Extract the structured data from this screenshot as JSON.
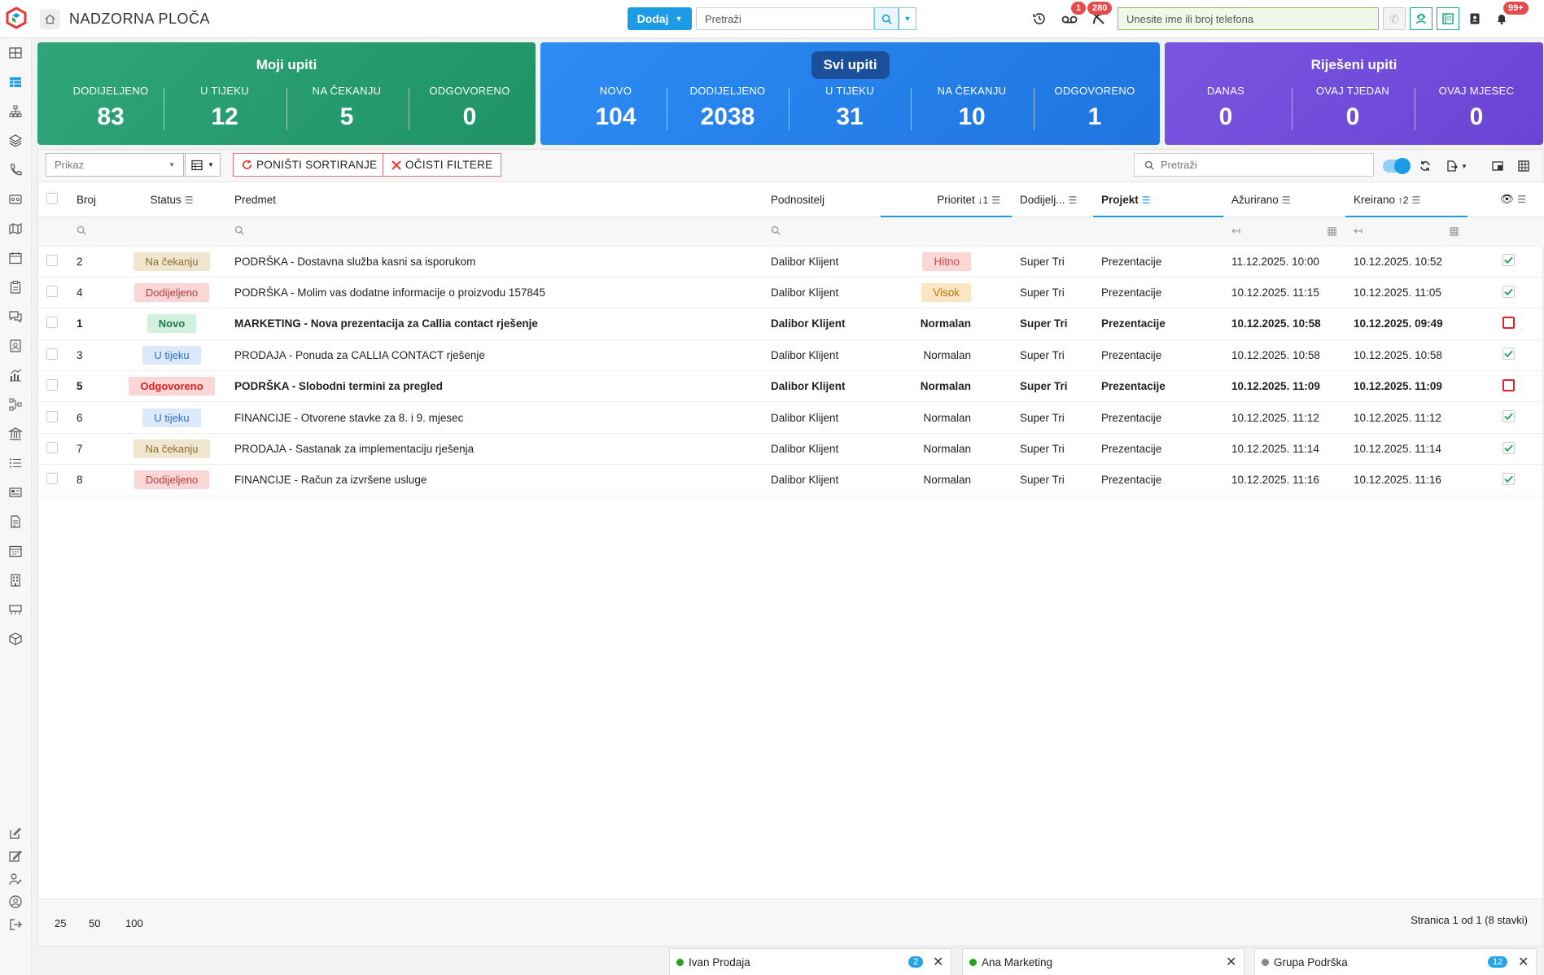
{
  "header": {
    "title": "NADZORNA PLOČA",
    "add_label": "Dodaj",
    "search_placeholder": "Pretraži",
    "voicemail_count": "1",
    "missed_calls_count": "280",
    "notifications_count": "99+",
    "phone_placeholder": "Unesite ime ili broj telefona"
  },
  "cards": {
    "moji": {
      "title": "Moji upiti",
      "stats": [
        {
          "label": "DODIJELJENO",
          "value": "83"
        },
        {
          "label": "U TIJEKU",
          "value": "12"
        },
        {
          "label": "NA ČEKANJU",
          "value": "5"
        },
        {
          "label": "ODGOVORENO",
          "value": "0"
        }
      ]
    },
    "svi": {
      "title": "Svi upiti",
      "stats": [
        {
          "label": "NOVO",
          "value": "104"
        },
        {
          "label": "DODIJELJENO",
          "value": "2038"
        },
        {
          "label": "U TIJEKU",
          "value": "31"
        },
        {
          "label": "NA ČEKANJU",
          "value": "10"
        },
        {
          "label": "ODGOVORENO",
          "value": "1"
        }
      ]
    },
    "rijeseni": {
      "title": "Riješeni upiti",
      "stats": [
        {
          "label": "DANAS",
          "value": "0"
        },
        {
          "label": "OVAJ TJEDAN",
          "value": "0"
        },
        {
          "label": "OVAJ MJESEC",
          "value": "0"
        }
      ]
    }
  },
  "toolbar": {
    "view_placeholder": "Prikaz",
    "reset_sort_label": "PONIŠTI SORTIRANJE",
    "clear_filters_label": "OČISTI FILTERE",
    "search_placeholder": "Pretraži"
  },
  "table": {
    "columns": {
      "broj": "Broj",
      "status": "Status",
      "predmet": "Predmet",
      "podnositelj": "Podnositelj",
      "prioritet": "Prioritet",
      "prioritet_sort": "↓1",
      "dodijeljeno": "Dodijelj...",
      "projekt": "Projekt",
      "azurirano": "Ažurirano",
      "kreirano": "Kreirano",
      "kreirano_sort": "↑2"
    },
    "rows": [
      {
        "broj": "2",
        "status": "Na čekanju",
        "predmet": "PODRŠKA - Dostavna služba kasni sa isporukom",
        "podnositelj": "Dalibor Klijent",
        "prioritet": "Hitno",
        "dodijeljeno": "Super Tri",
        "projekt": "Prezentacije",
        "azurirano": "11.12.2025. 10:00",
        "kreirano": "10.12.2025. 10:52"
      },
      {
        "broj": "4",
        "status": "Dodijeljeno",
        "predmet": "PODRŠKA - Molim vas dodatne informacije o proizvodu 157845",
        "podnositelj": "Dalibor Klijent",
        "prioritet": "Visok",
        "dodijeljeno": "Super Tri",
        "projekt": "Prezentacije",
        "azurirano": "10.12.2025. 11:15",
        "kreirano": "10.12.2025. 11:05"
      },
      {
        "broj": "1",
        "status": "Novo",
        "predmet": "MARKETING - Nova prezentacija za Callia contact rješenje",
        "podnositelj": "Dalibor Klijent",
        "prioritet": "Normalan",
        "dodijeljeno": "Super Tri",
        "projekt": "Prezentacije",
        "azurirano": "10.12.2025. 10:58",
        "kreirano": "10.12.2025. 09:49"
      },
      {
        "broj": "3",
        "status": "U tijeku",
        "predmet": "PRODAJA - Ponuda za CALLIA CONTACT rješenje",
        "podnositelj": "Dalibor Klijent",
        "prioritet": "Normalan",
        "dodijeljeno": "Super Tri",
        "projekt": "Prezentacije",
        "azurirano": "10.12.2025. 10:58",
        "kreirano": "10.12.2025. 10:58"
      },
      {
        "broj": "5",
        "status": "Odgovoreno",
        "predmet": "PODRŠKA - Slobodni termini za pregled",
        "podnositelj": "Dalibor Klijent",
        "prioritet": "Normalan",
        "dodijeljeno": "Super Tri",
        "projekt": "Prezentacije",
        "azurirano": "10.12.2025. 11:09",
        "kreirano": "10.12.2025. 11:09"
      },
      {
        "broj": "6",
        "status": "U tijeku",
        "predmet": "FINANCIJE - Otvorene stavke za 8. i 9. mjesec",
        "podnositelj": "Dalibor Klijent",
        "prioritet": "Normalan",
        "dodijeljeno": "Super Tri",
        "projekt": "Prezentacije",
        "azurirano": "10.12.2025. 11:12",
        "kreirano": "10.12.2025. 11:12"
      },
      {
        "broj": "7",
        "status": "Na čekanju",
        "predmet": "PRODAJA - Sastanak za implementaciju rješenja",
        "podnositelj": "Dalibor Klijent",
        "prioritet": "Normalan",
        "dodijeljeno": "Super Tri",
        "projekt": "Prezentacije",
        "azurirano": "10.12.2025. 11:14",
        "kreirano": "10.12.2025. 11:14"
      },
      {
        "broj": "8",
        "status": "Dodijeljeno",
        "predmet": "FINANCIJE - Račun za izvršene usluge",
        "podnositelj": "Dalibor Klijent",
        "prioritet": "Normalan",
        "dodijeljeno": "Super Tri",
        "projekt": "Prezentacije",
        "azurirano": "10.12.2025. 11:16",
        "kreirano": "10.12.2025. 11:16"
      }
    ]
  },
  "pager": {
    "sizes": [
      "25",
      "50",
      "100"
    ],
    "summary": "Stranica 1 od 1 (8 stavki)"
  },
  "chats": [
    {
      "name": "Ivan Prodaja",
      "count": "2"
    },
    {
      "name": "Ana Marketing",
      "count": ""
    },
    {
      "name": "Grupa Podrška",
      "count": "12"
    }
  ]
}
